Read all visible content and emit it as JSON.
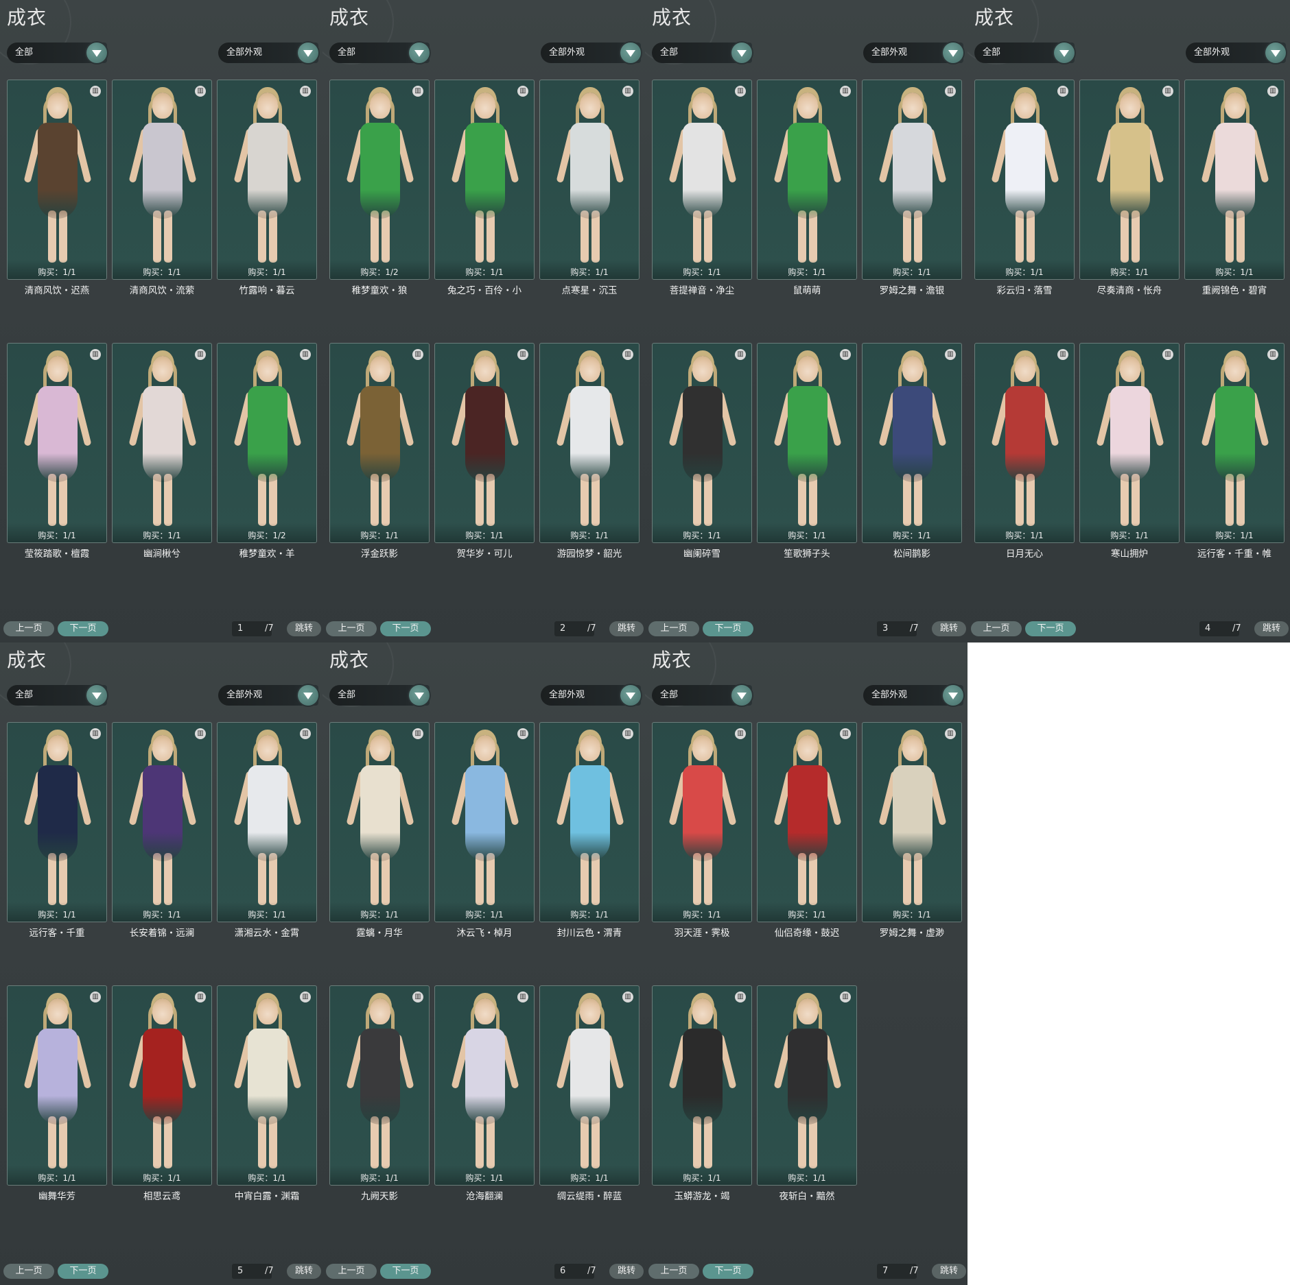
{
  "panels": [
    {
      "title": "成衣",
      "filter_left": "全部",
      "filter_right": "全部外观",
      "prev_label": "上一页",
      "next_label": "下一页",
      "page_current": "1",
      "page_total": "/7",
      "jump_label": "跳转",
      "items": [
        {
          "name": "清商风饮・迟燕",
          "buy": "购买：1/1",
          "outfit": "#5a4330"
        },
        {
          "name": "清商风饮・流萦",
          "buy": "购买：1/1",
          "outfit": "#c9c6cf"
        },
        {
          "name": "竹露响・暮云",
          "buy": "购买：1/1",
          "outfit": "#d8d5d0"
        },
        {
          "name": "莹筱踏歌・檀霞",
          "buy": "购买：1/1",
          "outfit": "#d9b8d4"
        },
        {
          "name": "幽涧楸兮",
          "buy": "购买：1/1",
          "outfit": "#e2d8d6"
        },
        {
          "name": "稚梦童欢・羊",
          "buy": "购买：1/2",
          "outfit": "#3aa14a"
        }
      ]
    },
    {
      "title": "成衣",
      "filter_left": "全部",
      "filter_right": "全部外观",
      "prev_label": "上一页",
      "next_label": "下一页",
      "page_current": "2",
      "page_total": "/7",
      "jump_label": "跳转",
      "items": [
        {
          "name": "稚梦童欢・狼",
          "buy": "购买：1/2",
          "outfit": "#3aa14a"
        },
        {
          "name": "兔之巧・百伶・小",
          "buy": "购买：1/1",
          "outfit": "#3aa14a"
        },
        {
          "name": "点寒星・沉玉",
          "buy": "购买：1/1",
          "outfit": "#d7dcdc"
        },
        {
          "name": "浮金跃影",
          "buy": "购买：1/1",
          "outfit": "#7b6236"
        },
        {
          "name": "贺华岁・可儿",
          "buy": "购买：1/1",
          "outfit": "#4b2524"
        },
        {
          "name": "游园惊梦・韶光",
          "buy": "购买：1/1",
          "outfit": "#e6e8ea"
        }
      ]
    },
    {
      "title": "成衣",
      "filter_left": "全部",
      "filter_right": "全部外观",
      "prev_label": "上一页",
      "next_label": "下一页",
      "page_current": "3",
      "page_total": "/7",
      "jump_label": "跳转",
      "items": [
        {
          "name": "菩提禅音・净尘",
          "buy": "购买：1/1",
          "outfit": "#e3e3e3"
        },
        {
          "name": "鼠萌萌",
          "buy": "购买：1/1",
          "outfit": "#3aa14a"
        },
        {
          "name": "罗姆之舞・澹银",
          "buy": "购买：1/1",
          "outfit": "#d6d8dc"
        },
        {
          "name": "幽阑碎雪",
          "buy": "购买：1/1",
          "outfit": "#303030"
        },
        {
          "name": "笙歌狮子头",
          "buy": "购买：1/1",
          "outfit": "#3aa14a"
        },
        {
          "name": "松间鹊影",
          "buy": "购买：1/1",
          "outfit": "#3c4a7a"
        }
      ]
    },
    {
      "title": "成衣",
      "filter_left": "全部",
      "filter_right": "全部外观",
      "prev_label": "上一页",
      "next_label": "下一页",
      "page_current": "4",
      "page_total": "/7",
      "jump_label": "跳转",
      "items": [
        {
          "name": "彩云归・落雪",
          "buy": "购买：1/1",
          "outfit": "#eef0f6"
        },
        {
          "name": "尽奏清商・怅舟",
          "buy": "购买：1/1",
          "outfit": "#d6c18a"
        },
        {
          "name": "重阙锦色・碧宵",
          "buy": "购买：1/1",
          "outfit": "#ebdada"
        },
        {
          "name": "日月无心",
          "buy": "购买：1/1",
          "outfit": "#b53a36"
        },
        {
          "name": "寒山拥炉",
          "buy": "购买：1/1",
          "outfit": "#ecd6dd"
        },
        {
          "name": "远行客・千重・帷",
          "buy": "购买：1/1",
          "outfit": "#3aa14a"
        }
      ]
    },
    {
      "title": "成衣",
      "filter_left": "全部",
      "filter_right": "全部外观",
      "prev_label": "上一页",
      "next_label": "下一页",
      "page_current": "5",
      "page_total": "/7",
      "jump_label": "跳转",
      "items": [
        {
          "name": "远行客・千重",
          "buy": "购买：1/1",
          "outfit": "#1f2a48"
        },
        {
          "name": "长安着锦・远澜",
          "buy": "购买：1/1",
          "outfit": "#4d3676"
        },
        {
          "name": "潇湘云水・金霄",
          "buy": "购买：1/1",
          "outfit": "#e7e9ec"
        },
        {
          "name": "幽舞华芳",
          "buy": "购买：1/1",
          "outfit": "#b7b2dc"
        },
        {
          "name": "相思云鸢",
          "buy": "购买：1/1",
          "outfit": "#a5221f"
        },
        {
          "name": "中宵白露・渊霜",
          "buy": "购买：1/1",
          "outfit": "#e7e3d3"
        }
      ]
    },
    {
      "title": "成衣",
      "filter_left": "全部",
      "filter_right": "全部外观",
      "prev_label": "上一页",
      "next_label": "下一页",
      "page_current": "6",
      "page_total": "/7",
      "jump_label": "跳转",
      "items": [
        {
          "name": "霆螭・月华",
          "buy": "购买：1/1",
          "outfit": "#e8e0cf"
        },
        {
          "name": "沐云飞・棹月",
          "buy": "购买：1/1",
          "outfit": "#8ab8e0"
        },
        {
          "name": "封川云色・渭青",
          "buy": "购买：1/1",
          "outfit": "#6fc0e0"
        },
        {
          "name": "九阙天影",
          "buy": "购买：1/1",
          "outfit": "#3a3a3c"
        },
        {
          "name": "沧海翻澜",
          "buy": "购买：1/1",
          "outfit": "#d8d5e4"
        },
        {
          "name": "绸云缇雨・醉蓝",
          "buy": "购买：1/1",
          "outfit": "#e6e7e8"
        }
      ]
    },
    {
      "title": "成衣",
      "filter_left": "全部",
      "filter_right": "全部外观",
      "prev_label": "上一页",
      "next_label": "下一页",
      "page_current": "7",
      "page_total": "/7",
      "jump_label": "跳转",
      "items": [
        {
          "name": "羽天涯・霁极",
          "buy": "购买：1/1",
          "outfit": "#d84a48"
        },
        {
          "name": "仙侣奇缘・鼓迟",
          "buy": "购买：1/1",
          "outfit": "#b52b2b"
        },
        {
          "name": "罗姆之舞・虚渺",
          "buy": "购买：1/1",
          "outfit": "#d9d1bd"
        },
        {
          "name": "玉蟒游龙・竭",
          "buy": "购买：1/1",
          "outfit": "#2b2b2b"
        },
        {
          "name": "夜斩白・黯然",
          "buy": "购买：1/1",
          "outfit": "#2f2f30"
        }
      ]
    }
  ]
}
